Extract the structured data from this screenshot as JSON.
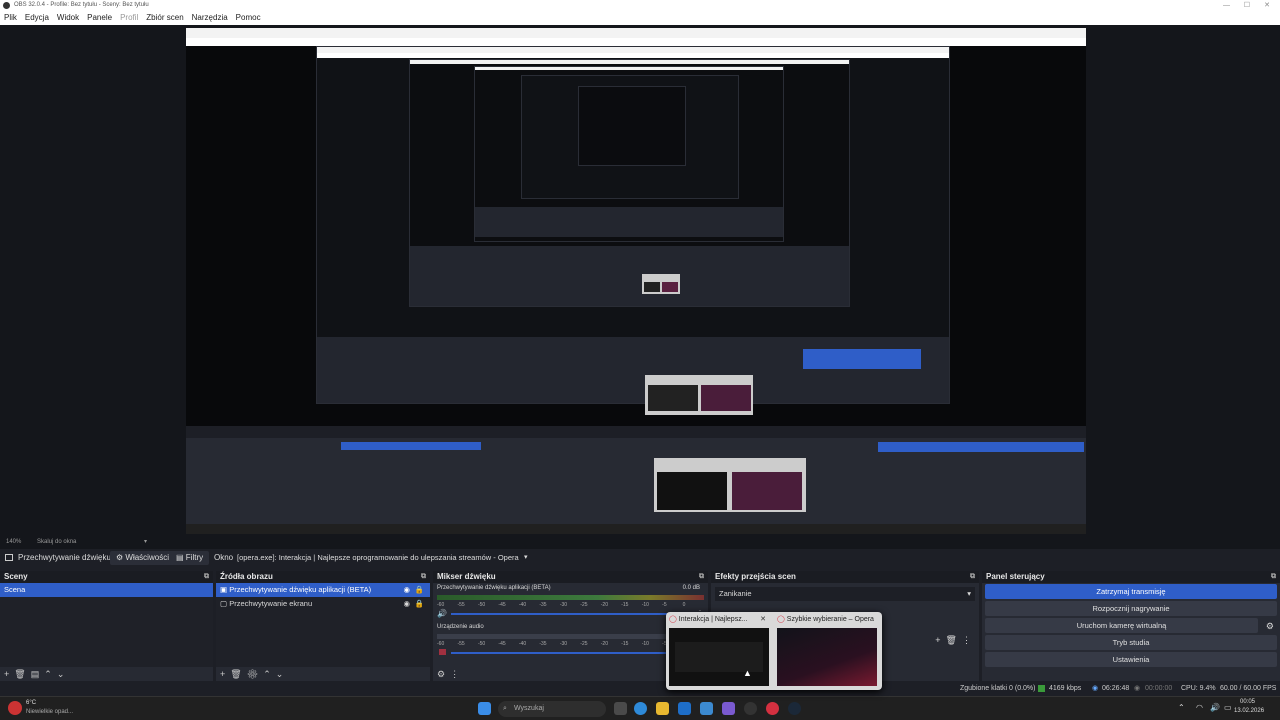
{
  "window": {
    "title": "OBS 32.0.4 - Profile: Bez tytułu - Sceny: Bez tytułu"
  },
  "menu": [
    "Plik",
    "Edycja",
    "Widok",
    "Panele",
    "Profil",
    "Zbiór scen",
    "Narzędzia",
    "Pomoc"
  ],
  "zoom": {
    "value": "140%",
    "fit_label": "Skaluj do okna"
  },
  "source_toolbar": {
    "source_name": "Przechwytywanie dźwięku",
    "properties_label": "Właściwości",
    "filters_label": "Filtry",
    "window_label": "Okno",
    "window_value": "[opera.exe]: Interakcja | Najlepsze oprogramowanie do ulepszania streamów - Opera"
  },
  "scenes": {
    "title": "Sceny",
    "items": [
      "Scena"
    ]
  },
  "sources": {
    "title": "Źródła obrazu",
    "items": [
      "Przechwytywanie dźwięku aplikacji (BETA)",
      "Przechwytywanie ekranu"
    ]
  },
  "mixer": {
    "title": "Mikser dźwięku",
    "channels": [
      {
        "name": "Przechwytywanie dźwięku aplikacji (BETA)",
        "db": "0.0 dB"
      },
      {
        "name": "Urządzenie audio",
        "db": ""
      }
    ],
    "scale": [
      "-60",
      "-55",
      "-50",
      "-45",
      "-40",
      "-35",
      "-30",
      "-25",
      "-20",
      "-15",
      "-10",
      "-5",
      "0"
    ]
  },
  "transitions": {
    "title": "Efekty przejścia scen",
    "selected": "Zanikanie"
  },
  "controls": {
    "title": "Panel sterujący",
    "buttons": [
      "Zatrzymaj transmisję",
      "Rozpocznij nagrywanie",
      "Uruchom kamerę wirtualną",
      "Tryb studia",
      "Ustawienia"
    ]
  },
  "status": {
    "dropped": "Zgubione klatki 0 (0.0%)",
    "bitrate": "4169 kbps",
    "stream_time": "06:26:48",
    "rec_time": "00:00:00",
    "cpu": "CPU: 9.4%",
    "fps": "60.00 / 60.00 FPS"
  },
  "taskbar": {
    "weather_temp": "6°C",
    "weather_desc": "Niewielkie opad...",
    "search_placeholder": "Wyszukaj",
    "time": "00:05",
    "date": "13.02.2026"
  },
  "popup": {
    "items": [
      {
        "title": "Interakcja | Najlepsz..."
      },
      {
        "title": "Szybkie wybieranie – Opera"
      }
    ]
  },
  "colors": {
    "accent": "#2f5ec8",
    "bg": "#1d1f26",
    "panel": "#272a33"
  }
}
